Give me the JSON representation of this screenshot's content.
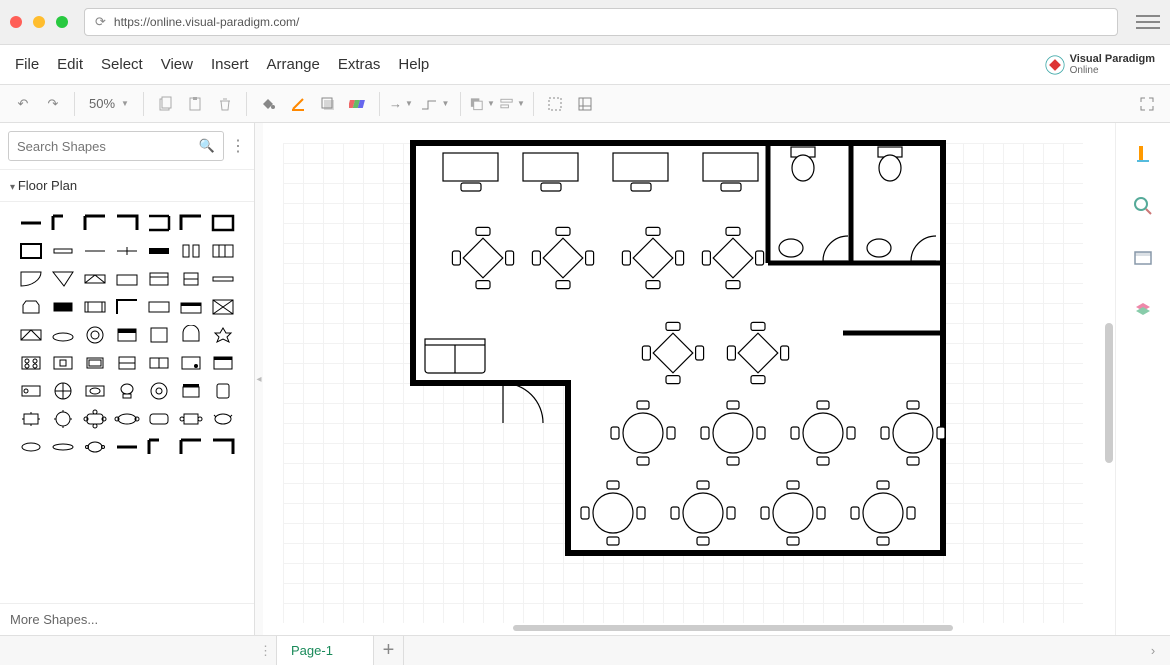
{
  "url": "https://online.visual-paradigm.com/",
  "menu": [
    "File",
    "Edit",
    "Select",
    "View",
    "Insert",
    "Arrange",
    "Extras",
    "Help"
  ],
  "logo": {
    "line1": "Visual Paradigm",
    "line2": "Online"
  },
  "zoom": "50%",
  "search_placeholder": "Search Shapes",
  "palette_header": "Floor Plan",
  "more_shapes": "More Shapes...",
  "tab_name": "Page-1",
  "shape_count": 63,
  "toolbar_icons": [
    "undo",
    "redo",
    "sep",
    "zoom",
    "sep",
    "copy",
    "paste",
    "delete",
    "sep",
    "fill",
    "stroke",
    "shadow",
    "style",
    "sep",
    "arrow",
    "line",
    "sep",
    "front",
    "back",
    "align",
    "sep",
    "grid",
    "fit"
  ],
  "right_icons": [
    "format",
    "search",
    "outline",
    "layers"
  ]
}
